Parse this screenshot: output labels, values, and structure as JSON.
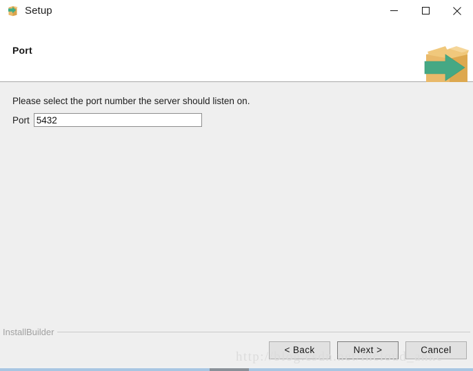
{
  "window": {
    "title": "Setup",
    "icon": "package-box-arrow-icon",
    "controls": {
      "minimize": "minimize-icon",
      "maximize": "maximize-icon",
      "close": "close-icon"
    }
  },
  "header": {
    "title": "Port",
    "logo": "installbuilder-box-arrow-logo",
    "logo_colors": {
      "box_front": "#e9b96a",
      "box_side": "#dda84f",
      "box_flap": "#f0c87c",
      "arrow": "#45a884"
    }
  },
  "main": {
    "instruction": "Please select the port number the server should listen on.",
    "port_field": {
      "label": "Port",
      "value": "5432",
      "placeholder": ""
    }
  },
  "footer": {
    "brand": "InstallBuilder",
    "buttons": {
      "back": "< Back",
      "next": "Next >",
      "cancel": "Cancel"
    }
  },
  "watermark": {
    "text": "http://blog.csdn.net/incloud_anke"
  },
  "colors": {
    "titlebar_bg": "#ffffff",
    "header_bg": "#ffffff",
    "body_bg": "#efefef",
    "separator": "#a9a9a9",
    "button_bg": "#e1e1e1",
    "button_border": "#adadad",
    "scrollbar_track": "#a8c6e2",
    "scrollbar_thumb": "#8a9199"
  }
}
